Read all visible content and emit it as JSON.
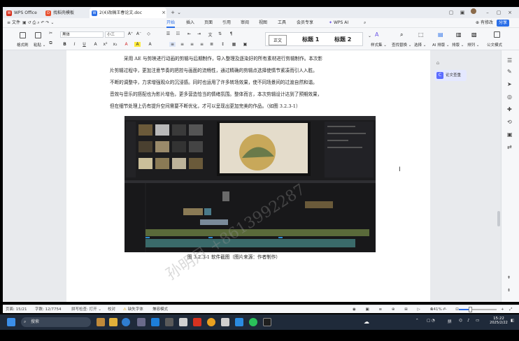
{
  "tabs": [
    {
      "label": "WPS Office",
      "icon": "wps-logo-icon",
      "color": "#d6321f"
    },
    {
      "label": "找稻壳模板",
      "icon": "docer-icon",
      "color": "#e84f2e"
    },
    {
      "label": "2(4)改稿王春论文.doc",
      "icon": "word-doc-icon",
      "color": "#2b6fe8"
    }
  ],
  "menu": [
    "文件",
    "开始",
    "插入",
    "页面",
    "引用",
    "审阅",
    "视图",
    "工具",
    "会员专享",
    "WPS AI"
  ],
  "menu_selected": "开始",
  "top_right": {
    "edit_label": "有修改",
    "share_label": "分享"
  },
  "ribbon": {
    "format_painter": "格式刷",
    "paste": "粘贴",
    "font": "黑体",
    "size": "小三",
    "style_normal": "正文",
    "style_h1": "标题 1",
    "style_h2": "标题 2",
    "style_set": "样式集",
    "find_replace": "查找替换",
    "select": "选择",
    "ai_layout": "AI 排版",
    "layout": "排版",
    "typeset": "排列",
    "doc_style": "公文模式"
  },
  "document": {
    "paragraph_lines": [
      "采用 AE 与剪映进行动画的剪辑与后期制作，导入整理及逐染好的所有素材进行剪辑制作。本次影",
      "片剪辑过程中，更加注意节奏的把控与画面的流畅性，通过精确的剪辑点选择使情节紧凑而引人入胜。",
      "不断的调整中，力求增强观众的沉浸感。同时也运用了许多转场效果，使不同场景间的过渡自然和谐。",
      "音效与音乐的搭配也为影片增色，更多营造恰当的情绪氛围。整体而言，本次剪辑设计达到了预期效果，",
      "但在细节处理上仍有提升空间需要不断优化，才可以呈现出更加完美的作品。（如图 3.2.3-1）"
    ],
    "caption": "图 3.2.3-1  软件截图（图片来源：作者制作）"
  },
  "float_button": "论文查重",
  "status": {
    "page": "页面: 15/21",
    "words": "字数: 12/7754",
    "spell": "拼写检查: 打开",
    "proof": "校对",
    "font_missing": "缺失字体",
    "compat": "兼容模式",
    "zoom": "141%"
  },
  "taskbar": {
    "search": "搜索",
    "ime": "拼",
    "time": "15:22",
    "date": "2025/2/22"
  },
  "watermark": "孙明月 +8613992287"
}
